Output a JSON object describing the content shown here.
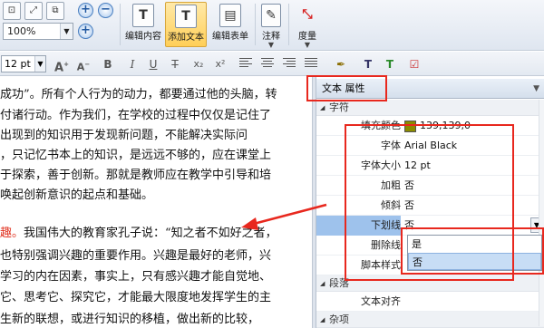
{
  "ribbon": {
    "zoom_value": "100%",
    "buttons": [
      {
        "label": "编辑内容",
        "active": false
      },
      {
        "label": "添加文本",
        "active": true
      },
      {
        "label": "编辑表单",
        "active": false
      },
      {
        "label": "注释",
        "active": false
      },
      {
        "label": "度量",
        "active": false
      }
    ]
  },
  "format_bar": {
    "font_size": "12 pt",
    "bold": "B",
    "italic": "I",
    "underline": "U",
    "strike": "T",
    "subscript": "x₂",
    "superscript": "x²",
    "grow": "A",
    "shrink": "A"
  },
  "document": {
    "lines": [
      "成功”。所有个人行为的动力，都要通过他的头脑，转",
      "付诸行动。作为我们，在学校的过程中仅仅是记住了",
      "出现到的知识用于发现新问题，不能解决实际问",
      "，只记忆书本上的知识，是远远不够的，应在课堂上",
      "于探索，善于创新。那就是教师应在教学中引导和培",
      "唤起创新意识的起点和基础。",
      "我国伟大的教育家孔子说：“知之者不如好之者，",
      "也特别强调兴趣的重要作用。兴趣是最好的老师，兴",
      "学习的内在因素，事实上，只有感兴趣才能自觉地、",
      "它、思考它、探究它，才能最大限度地发挥学生的主",
      "生新的联想，或进行知识的移植，做出新的比较，"
    ],
    "red_prefix": "趣。"
  },
  "panel": {
    "title": "文本 属性",
    "categories": {
      "char": "字符",
      "para": "段落",
      "misc": "杂项"
    },
    "rows": {
      "fill_color": {
        "label": "填充颜色",
        "value": "139,139,0"
      },
      "font": {
        "label": "字体",
        "value": "Arial Black"
      },
      "font_size": {
        "label": "字体大小",
        "value": "12 pt"
      },
      "bold": {
        "label": "加粗",
        "value": "否"
      },
      "italic": {
        "label": "倾斜",
        "value": "否"
      },
      "underline": {
        "label": "下划线",
        "value": "否"
      },
      "strikethrough": {
        "label": "删除线",
        "value": ""
      },
      "script_style": {
        "label": "脚本样式",
        "value": ""
      },
      "text_align": {
        "label": "文本对齐",
        "value": ""
      }
    },
    "dropdown_options": [
      "是",
      "否"
    ],
    "dropdown_selected": "否"
  },
  "colors": {
    "annotation_red": "#e8281e",
    "fill_swatch": "#8b8b00",
    "active_button": "#ffcf58",
    "selection": "#9ec2ec"
  }
}
